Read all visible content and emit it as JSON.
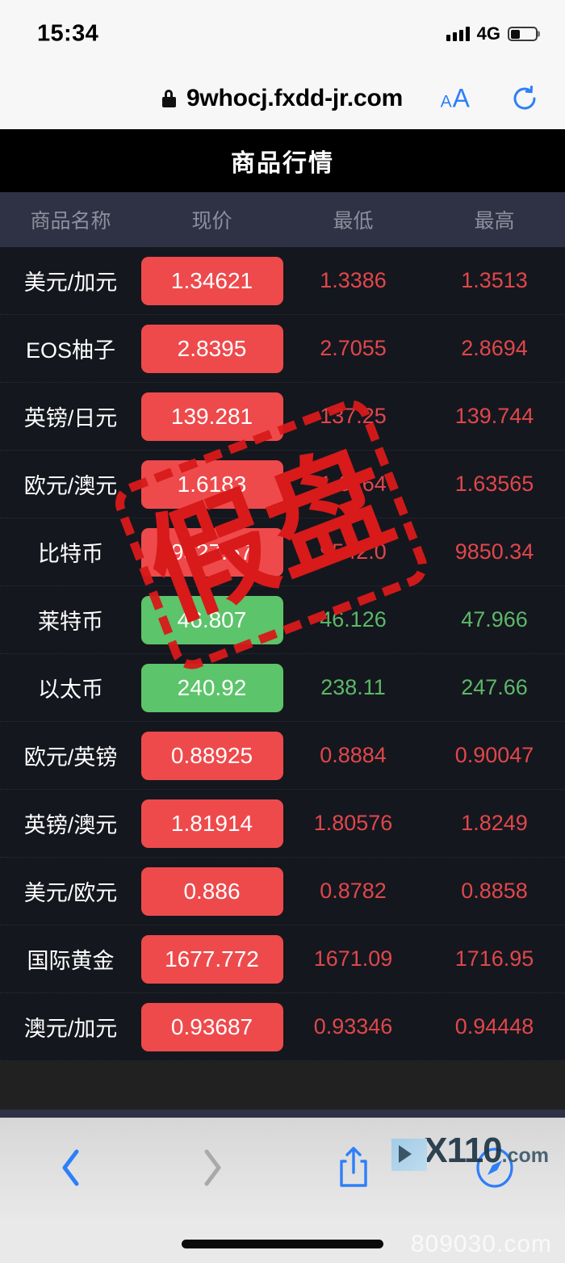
{
  "status_bar": {
    "time": "15:34",
    "network": "4G",
    "signal_icon": "signal-bars-icon",
    "battery_icon": "battery-icon"
  },
  "browser": {
    "lock_icon": "lock-icon",
    "url": "9whocj.fxdd-jr.com",
    "text_size_label_small": "A",
    "text_size_label_large": "A",
    "reload_icon": "reload-icon",
    "back_icon": "chevron-left-icon",
    "forward_icon": "chevron-right-icon",
    "share_icon": "share-icon",
    "tabs_icon": "compass-icon"
  },
  "page": {
    "title": "商品行情"
  },
  "table": {
    "headers": [
      "商品名称",
      "现价",
      "最低",
      "最高"
    ],
    "rows": [
      {
        "name": "美元/加元",
        "price": "1.34621",
        "low": "1.3386",
        "high": "1.3513",
        "dir": "up"
      },
      {
        "name": "EOS柚子",
        "price": "2.8395",
        "low": "2.7055",
        "high": "2.8694",
        "dir": "up"
      },
      {
        "name": "英镑/日元",
        "price": "139.281",
        "low": "137.25",
        "high": "139.744",
        "dir": "up"
      },
      {
        "name": "欧元/澳元",
        "price": "1.6183",
        "low": "1.6164",
        "high": "1.63565",
        "dir": "up"
      },
      {
        "name": "比特币",
        "price": "9527.57",
        "low": "9542.0",
        "high": "9850.34",
        "dir": "up"
      },
      {
        "name": "莱特币",
        "price": "46.807",
        "low": "46.126",
        "high": "47.966",
        "dir": "down"
      },
      {
        "name": "以太币",
        "price": "240.92",
        "low": "238.11",
        "high": "247.66",
        "dir": "down"
      },
      {
        "name": "欧元/英镑",
        "price": "0.88925",
        "low": "0.8884",
        "high": "0.90047",
        "dir": "up"
      },
      {
        "name": "英镑/澳元",
        "price": "1.81914",
        "low": "1.80576",
        "high": "1.8249",
        "dir": "up"
      },
      {
        "name": "美元/欧元",
        "price": "0.886",
        "low": "0.8782",
        "high": "0.8858",
        "dir": "up"
      },
      {
        "name": "国际黄金",
        "price": "1677.772",
        "low": "1671.09",
        "high": "1716.95",
        "dir": "up"
      },
      {
        "name": "澳元/加元",
        "price": "0.93687",
        "low": "0.93346",
        "high": "0.94448",
        "dir": "up"
      }
    ]
  },
  "watermarks": {
    "stamp_text": "假盘",
    "logo_text": "X110",
    "logo_suffix": ".com",
    "site": "809030.com"
  },
  "colors": {
    "up_red": "#ee4a4c",
    "down_green": "#5cc46a",
    "header_bg": "#2e3244",
    "row_bg": "#15171e",
    "stamp_red": "#d81a1a",
    "safari_blue": "#2d7ff9"
  }
}
